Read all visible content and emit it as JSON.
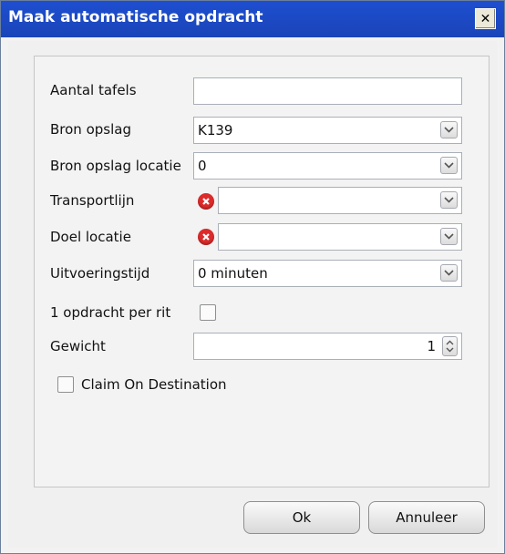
{
  "window": {
    "title": "Maak automatische opdracht",
    "close_symbol": "✕"
  },
  "form": {
    "aantal_tafels": {
      "label": "Aantal tafels",
      "value": ""
    },
    "bron_opslag": {
      "label": "Bron opslag",
      "value": "K139"
    },
    "bron_opslag_locatie": {
      "label": "Bron opslag locatie",
      "value": "0"
    },
    "transportlijn": {
      "label": "Transportlijn",
      "value": ""
    },
    "doel_locatie": {
      "label": "Doel locatie",
      "value": ""
    },
    "uitvoeringstijd": {
      "label": "Uitvoeringstijd",
      "value": "0 minuten"
    },
    "opdracht_per_rit": {
      "label": "1 opdracht per rit",
      "checked": false
    },
    "gewicht": {
      "label": "Gewicht",
      "value": "1"
    },
    "claim_on_destination": {
      "label": "Claim On Destination",
      "checked": false
    }
  },
  "buttons": {
    "ok": "Ok",
    "cancel": "Annuleer"
  },
  "colors": {
    "titlebar": "#1e4fd0",
    "error": "#dc2b2b"
  },
  "icons": [
    "close-icon",
    "chevron-down-icon",
    "error-icon",
    "spin-up-icon",
    "spin-down-icon"
  ]
}
